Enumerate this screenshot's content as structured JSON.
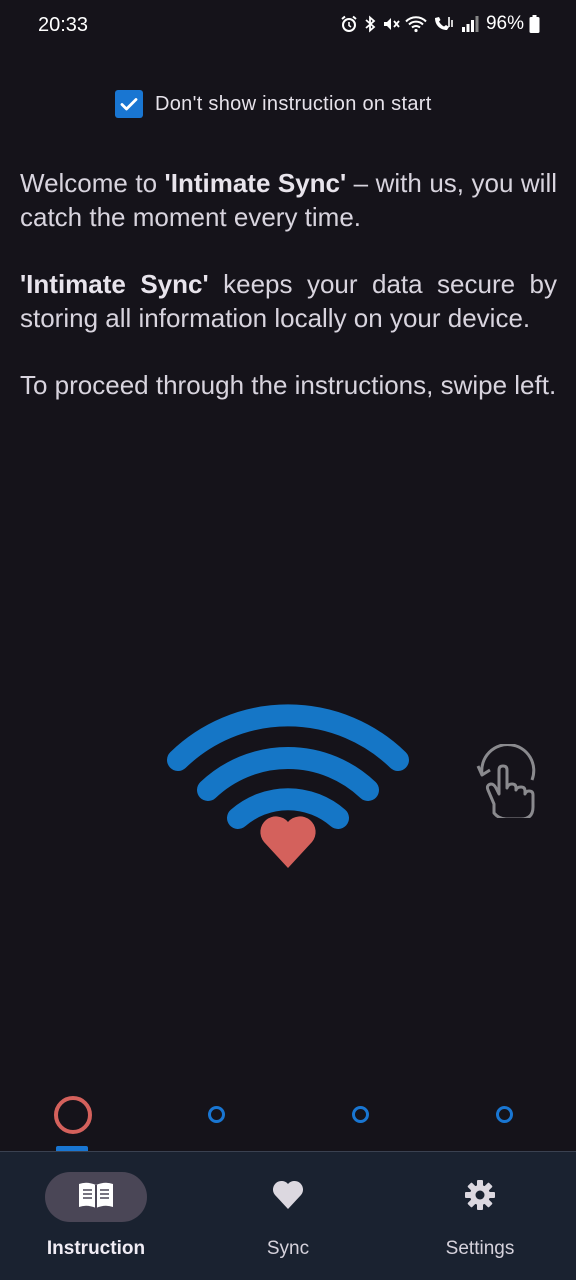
{
  "status_bar": {
    "time": "20:33",
    "battery_percent": "96%",
    "icons": [
      "alarm-icon",
      "bluetooth-icon",
      "mute-icon",
      "wifi-icon",
      "wifi-calling-icon",
      "signal-icon",
      "battery-icon"
    ]
  },
  "checkbox": {
    "label": "Don't show instruction on start",
    "checked": true
  },
  "content": {
    "p1_prefix": "Welcome to ",
    "p1_brand": "'Intimate Sync'",
    "p1_suffix": " – with us, you will catch the moment every time.",
    "p2_brand": "'Intimate Sync'",
    "p2_suffix": " keeps your data secure by storing all information locally on your device.",
    "p3": "To proceed through the instructions, swipe left."
  },
  "illustration": {
    "icon": "wifi-heart-icon",
    "swipe_hint_icon": "swipe-gesture-icon"
  },
  "pager": {
    "pages": 4,
    "current": 1
  },
  "bottom_nav": {
    "items": [
      {
        "label": "Instruction",
        "icon": "book-icon",
        "active": true
      },
      {
        "label": "Sync",
        "icon": "heart-icon",
        "active": false
      },
      {
        "label": "Settings",
        "icon": "gear-icon",
        "active": false
      }
    ]
  },
  "colors": {
    "background": "#15131a",
    "accent_blue": "#1976d2",
    "heart": "#d4615c",
    "nav_background": "#1a2230"
  }
}
